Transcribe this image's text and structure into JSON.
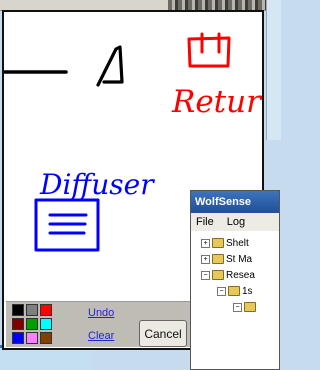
{
  "canvas": {
    "annotations": [
      "Return",
      "Diffuser"
    ]
  },
  "toolbar": {
    "palette": [
      {
        "name": "black",
        "color": "#000000"
      },
      {
        "name": "gray",
        "color": "#808080"
      },
      {
        "name": "red",
        "color": "#ff0000"
      },
      {
        "name": "dark-red",
        "color": "#800000"
      },
      {
        "name": "green",
        "color": "#00a000"
      },
      {
        "name": "cyan",
        "color": "#00ffff"
      },
      {
        "name": "blue",
        "color": "#0000ff"
      },
      {
        "name": "magenta",
        "color": "#ff80ff"
      },
      {
        "name": "brown",
        "color": "#804000"
      }
    ],
    "undo_label": "Undo",
    "clear_label": "Clear",
    "cancel_label": "Cancel"
  },
  "popup": {
    "title": "WolfSense",
    "menu": [
      "File",
      "Log"
    ],
    "tree": [
      {
        "label": "Shelt"
      },
      {
        "label": "St Ma"
      },
      {
        "label": "Resea"
      },
      {
        "label": "1s"
      },
      {
        "label": ""
      }
    ]
  },
  "colors": {
    "ink_black": "#000000",
    "ink_red": "#ff0000",
    "ink_blue": "#0000ff",
    "titlebar": "#2b5ea8"
  }
}
